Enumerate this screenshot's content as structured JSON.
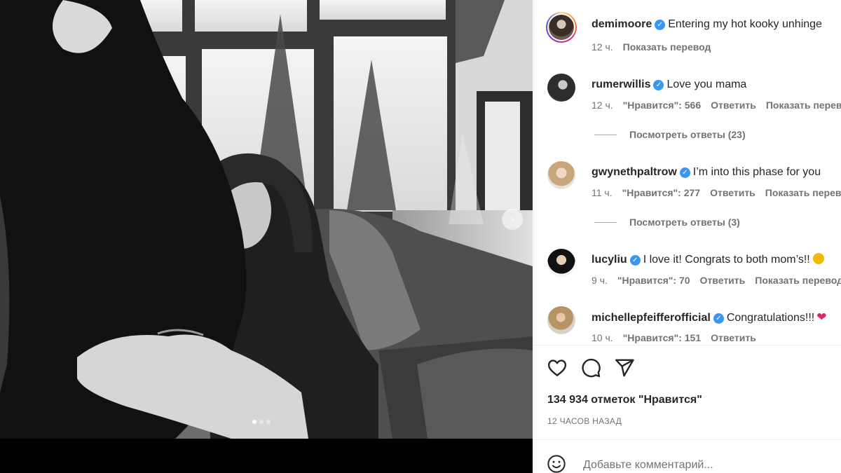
{
  "post": {
    "carousel": {
      "slide_count": 3,
      "active_index": 0
    },
    "caption": {
      "username": "demimoore",
      "text": "Entering my hot kooky unhinge",
      "time": "12 ч.",
      "translate": "Показать перевод"
    }
  },
  "comments": [
    {
      "username": "rumerwillis",
      "text": "Love you mama",
      "time": "12 ч.",
      "likes": "\"Нравится\": 566",
      "reply": "Ответить",
      "translate": "Показать перев",
      "replies": "Посмотреть ответы (23)"
    },
    {
      "username": "gwynethpaltrow",
      "text": "I’m into this phase for you",
      "time": "11 ч.",
      "likes": "\"Нравится\": 277",
      "reply": "Ответить",
      "translate": "Показать перев",
      "replies": "Посмотреть ответы (3)"
    },
    {
      "username": "lucyliu",
      "text": "I love it! Congrats to both mom’s!!",
      "emoji": "grinning-face-emoji",
      "time": "9 ч.",
      "likes": "\"Нравится\": 70",
      "reply": "Ответить",
      "translate": "Показать перевод"
    },
    {
      "username": "michellepfeifferofficial",
      "text": "Congratulations!!!",
      "emoji": "red-heart-emoji",
      "time": "10 ч.",
      "likes": "\"Нравится\": 151",
      "reply": "Ответить"
    }
  ],
  "actions": {
    "icons": [
      "heart-icon",
      "comment-icon",
      "share-icon"
    ]
  },
  "likes_count": "134 934 отметок \"Нравится\"",
  "posted_ago": "12 ЧАСОВ НАЗАД",
  "add_comment": {
    "placeholder": "Добавьте комментарий..."
  },
  "colors": {
    "verified": "#3897f0",
    "secondary_text": "#737373",
    "primary_text": "#262626"
  }
}
